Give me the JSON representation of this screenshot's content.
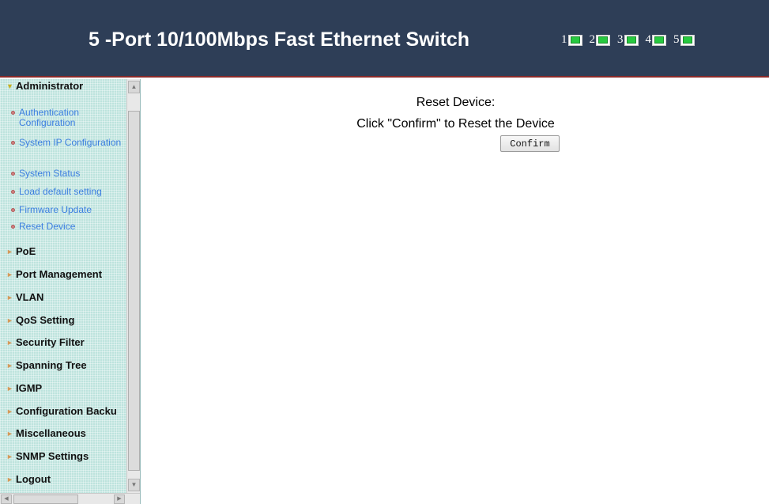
{
  "header": {
    "title": "5 -Port 10/100Mbps  Fast Ethernet Switch",
    "ports": [
      {
        "number": "1",
        "status": "link-up",
        "led_color": "#27c93f"
      },
      {
        "number": "2",
        "status": "link-up",
        "led_color": "#27c93f"
      },
      {
        "number": "3",
        "status": "link-up",
        "led_color": "#27c93f"
      },
      {
        "number": "4",
        "status": "link-up",
        "led_color": "#27c93f"
      },
      {
        "number": "5",
        "status": "link-up",
        "led_color": "#27c93f"
      }
    ]
  },
  "sidebar": {
    "administrator": {
      "label": "Administrator",
      "items": [
        {
          "label": "Authentication Configuration"
        },
        {
          "label": "System IP Configuration"
        },
        {
          "label": "System Status"
        },
        {
          "label": "Load default setting"
        },
        {
          "label": "Firmware Update"
        },
        {
          "label": "Reset Device"
        }
      ]
    },
    "menus": [
      {
        "label": "PoE"
      },
      {
        "label": "Port Management"
      },
      {
        "label": "VLAN"
      },
      {
        "label": "QoS Setting"
      },
      {
        "label": "Security Filter"
      },
      {
        "label": "Spanning Tree"
      },
      {
        "label": "IGMP"
      },
      {
        "label": "Configuration Backu"
      },
      {
        "label": "Miscellaneous"
      },
      {
        "label": "SNMP Settings"
      },
      {
        "label": "Logout"
      }
    ]
  },
  "main": {
    "title": "Reset Device:",
    "instruction": "Click \"Confirm\" to Reset the Device",
    "confirm_label": "Confirm"
  },
  "colors": {
    "header_bg": "#2e3e57",
    "sidebar_bg": "#bde3dd",
    "link": "#3b7ee0"
  }
}
